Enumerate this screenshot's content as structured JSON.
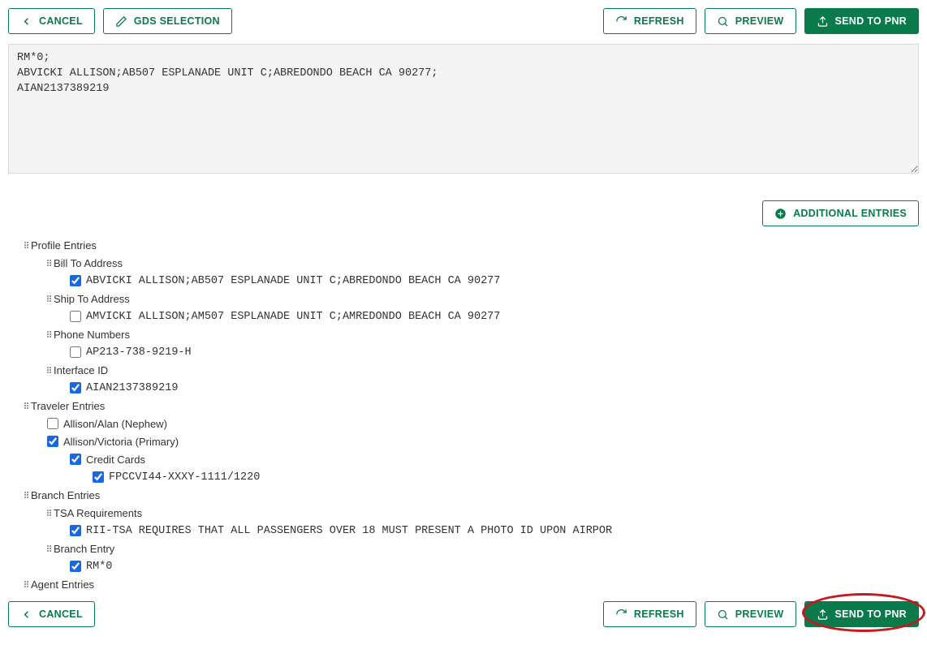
{
  "toolbar": {
    "cancel": "CANCEL",
    "gds_selection": "GDS SELECTION",
    "refresh": "REFRESH",
    "preview": "PREVIEW",
    "send_to_pnr": "SEND TO PNR",
    "additional_entries": "ADDITIONAL ENTRIES"
  },
  "code_preview": "RM*0;\nABVICKI ALLISON;AB507 ESPLANADE UNIT C;ABREDONDO BEACH CA 90277;\nAIAN2137389219",
  "tree": {
    "profile_entries": "Profile Entries",
    "bill_to_address": "Bill To Address",
    "bill_to_value": "ABVICKI ALLISON;AB507 ESPLANADE UNIT C;ABREDONDO BEACH CA 90277",
    "ship_to_address": "Ship To Address",
    "ship_to_value": "AMVICKI ALLISON;AM507 ESPLANADE UNIT C;AMREDONDO BEACH CA 90277",
    "phone_numbers": "Phone Numbers",
    "phone_value": "AP213-738-9219-H",
    "interface_id": "Interface ID",
    "interface_value": "AIAN2137389219",
    "traveler_entries": "Traveler Entries",
    "allison_alan": "Allison/Alan (Nephew)",
    "allison_victoria": "Allison/Victoria (Primary)",
    "credit_cards": "Credit Cards",
    "credit_card_value": "FPCCVI44-XXXY-1111/1220",
    "branch_entries": "Branch Entries",
    "tsa_requirements": "TSA Requirements",
    "tsa_value": "RII-TSA REQUIRES THAT ALL PASSENGERS OVER 18 MUST PRESENT A PHOTO ID UPON AIRPOR",
    "branch_entry": "Branch Entry",
    "branch_value": "RM*0",
    "agent_entries": "Agent Entries"
  }
}
